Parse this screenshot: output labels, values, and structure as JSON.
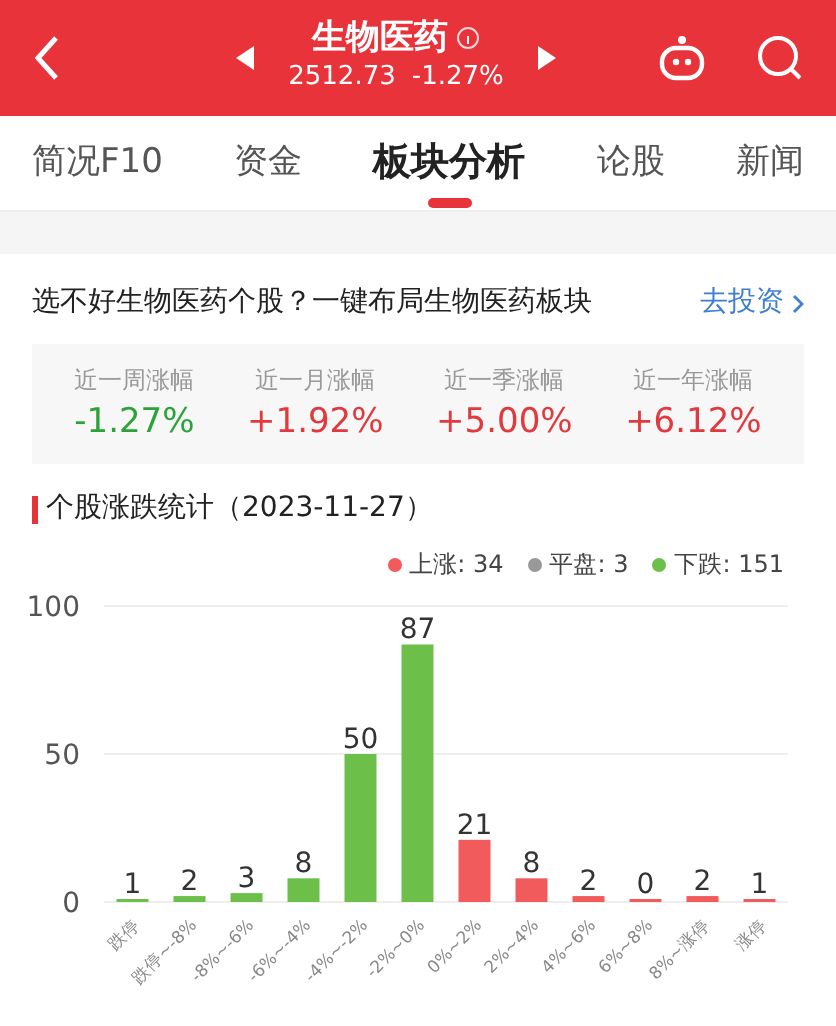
{
  "header": {
    "title": "生物医药",
    "price": "2512.73",
    "change": "-1.27%"
  },
  "tabs": [
    {
      "label": "简况F10",
      "selected": false
    },
    {
      "label": "资金",
      "selected": false
    },
    {
      "label": "板块分析",
      "selected": true
    },
    {
      "label": "论股",
      "selected": false
    },
    {
      "label": "新闻",
      "selected": false
    }
  ],
  "promo": {
    "text": "选不好生物医药个股？一键布局生物医药板块",
    "link": "去投资"
  },
  "stats": [
    {
      "label": "近一周涨幅",
      "value": "-1.27%",
      "color": "#2ea23a"
    },
    {
      "label": "近一月涨幅",
      "value": "+1.92%",
      "color": "#e0393e"
    },
    {
      "label": "近一季涨幅",
      "value": "+5.00%",
      "color": "#e0393e"
    },
    {
      "label": "近一年涨幅",
      "value": "+6.12%",
      "color": "#e0393e"
    }
  ],
  "section_title": "个股涨跌统计（2023-11-27）",
  "legend_separator": ": ",
  "legend_counts": [
    "34",
    "3",
    "151"
  ],
  "chart_data": {
    "type": "bar",
    "stacked": true,
    "data_labels": true,
    "categories": [
      "跌停",
      "跌停~-8%",
      "-8%~-6%",
      "-6%~-4%",
      "-4%~-2%",
      "-2%~0%",
      "0%~2%",
      "2%~4%",
      "4%~6%",
      "6%~8%",
      "8%~涨停",
      "涨停"
    ],
    "ylim": [
      0,
      100
    ],
    "yticks": [
      0,
      50,
      100
    ],
    "series": [
      {
        "name": "上涨",
        "color": "#f15b5b",
        "values": [
          null,
          null,
          null,
          null,
          null,
          null,
          21,
          8,
          2,
          0,
          2,
          1
        ]
      },
      {
        "name": "平盘",
        "color": "#999999",
        "values": [
          null,
          null,
          null,
          null,
          null,
          null,
          null,
          null,
          null,
          null,
          null,
          null
        ]
      },
      {
        "name": "下跌",
        "color": "#6cc04a",
        "values": [
          1,
          2,
          3,
          8,
          50,
          87,
          null,
          null,
          null,
          null,
          null,
          null
        ]
      }
    ]
  }
}
